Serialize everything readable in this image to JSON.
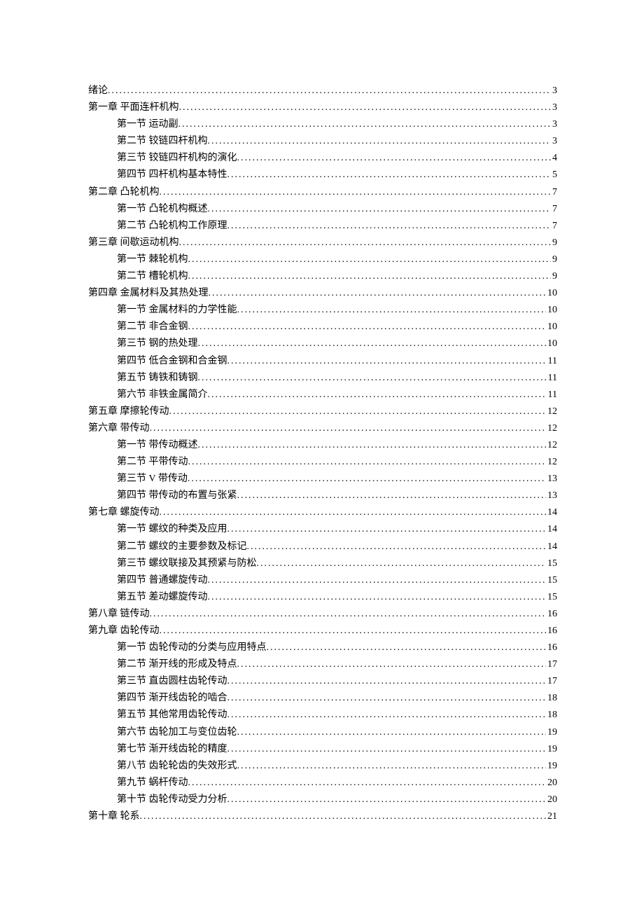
{
  "toc": [
    {
      "title": "绪论",
      "page": "3",
      "sub": false
    },
    {
      "title": "第一章  平面连杆机构",
      "page": "3",
      "sub": false
    },
    {
      "title": "第一节  运动副",
      "page": "3",
      "sub": true
    },
    {
      "title": "第二节  铰链四杆机构",
      "page": "3",
      "sub": true
    },
    {
      "title": "第三节  铰链四杆机构的演化",
      "page": "4",
      "sub": true
    },
    {
      "title": "第四节  四杆机构基本特性",
      "page": "5",
      "sub": true
    },
    {
      "title": "第二章  凸轮机构",
      "page": "7",
      "sub": false
    },
    {
      "title": "第一节  凸轮机构概述",
      "page": "7",
      "sub": true
    },
    {
      "title": "第二节  凸轮机构工作原理",
      "page": "7",
      "sub": true
    },
    {
      "title": "第三章  间歇运动机构",
      "page": "9",
      "sub": false
    },
    {
      "title": "第一节  棘轮机构",
      "page": "9",
      "sub": true
    },
    {
      "title": "第二节  槽轮机构",
      "page": "9",
      "sub": true
    },
    {
      "title": "第四章  金属材料及其热处理",
      "page": "10",
      "sub": false
    },
    {
      "title": "第一节  金属材料的力学性能",
      "page": "10",
      "sub": true
    },
    {
      "title": "第二节  非合金钢",
      "page": "10",
      "sub": true
    },
    {
      "title": "第三节  钢的热处理",
      "page": "10",
      "sub": true
    },
    {
      "title": "第四节  低合金钢和合金钢",
      "page": "11",
      "sub": true
    },
    {
      "title": "第五节  铸铁和铸钢",
      "page": "11",
      "sub": true
    },
    {
      "title": "第六节  非铁金属简介",
      "page": "11",
      "sub": true
    },
    {
      "title": "第五章  摩擦轮传动",
      "page": "12",
      "sub": false
    },
    {
      "title": "第六章  带传动",
      "page": "12",
      "sub": false
    },
    {
      "title": "第一节  带传动概述",
      "page": "12",
      "sub": true
    },
    {
      "title": "第二节  平带传动",
      "page": "12",
      "sub": true
    },
    {
      "title": "第三节  V 带传动",
      "page": "13",
      "sub": true
    },
    {
      "title": "第四节  带传动的布置与张紧",
      "page": "13",
      "sub": true
    },
    {
      "title": "第七章  螺旋传动",
      "page": "14",
      "sub": false
    },
    {
      "title": "第一节  螺纹的种类及应用",
      "page": "14",
      "sub": true
    },
    {
      "title": "第二节  螺纹的主要参数及标记",
      "page": "14",
      "sub": true
    },
    {
      "title": "第三节  螺纹联接及其预紧与防松",
      "page": "15",
      "sub": true
    },
    {
      "title": "第四节  普通螺旋传动",
      "page": "15",
      "sub": true
    },
    {
      "title": "第五节  差动螺旋传动",
      "page": "15",
      "sub": true
    },
    {
      "title": "第八章  链传动",
      "page": "16",
      "sub": false
    },
    {
      "title": "第九章  齿轮传动",
      "page": "16",
      "sub": false
    },
    {
      "title": "第一节  齿轮传动的分类与应用特点",
      "page": "16",
      "sub": true
    },
    {
      "title": "第二节  渐开线的形成及特点",
      "page": "17",
      "sub": true
    },
    {
      "title": "第三节  直齿圆柱齿轮传动",
      "page": "17",
      "sub": true
    },
    {
      "title": "第四节  渐开线齿轮的啮合",
      "page": "18",
      "sub": true
    },
    {
      "title": "第五节  其他常用齿轮传动",
      "page": "18",
      "sub": true
    },
    {
      "title": "第六节  齿轮加工与变位齿轮",
      "page": "19",
      "sub": true
    },
    {
      "title": "第七节  渐开线齿轮的精度",
      "page": "19",
      "sub": true
    },
    {
      "title": "第八节  齿轮轮齿的失效形式",
      "page": "19",
      "sub": true
    },
    {
      "title": "第九节  蜗杆传动",
      "page": "20",
      "sub": true
    },
    {
      "title": "第十节  齿轮传动受力分析",
      "page": "20",
      "sub": true
    },
    {
      "title": "第十章  轮系",
      "page": "21",
      "sub": false
    }
  ]
}
